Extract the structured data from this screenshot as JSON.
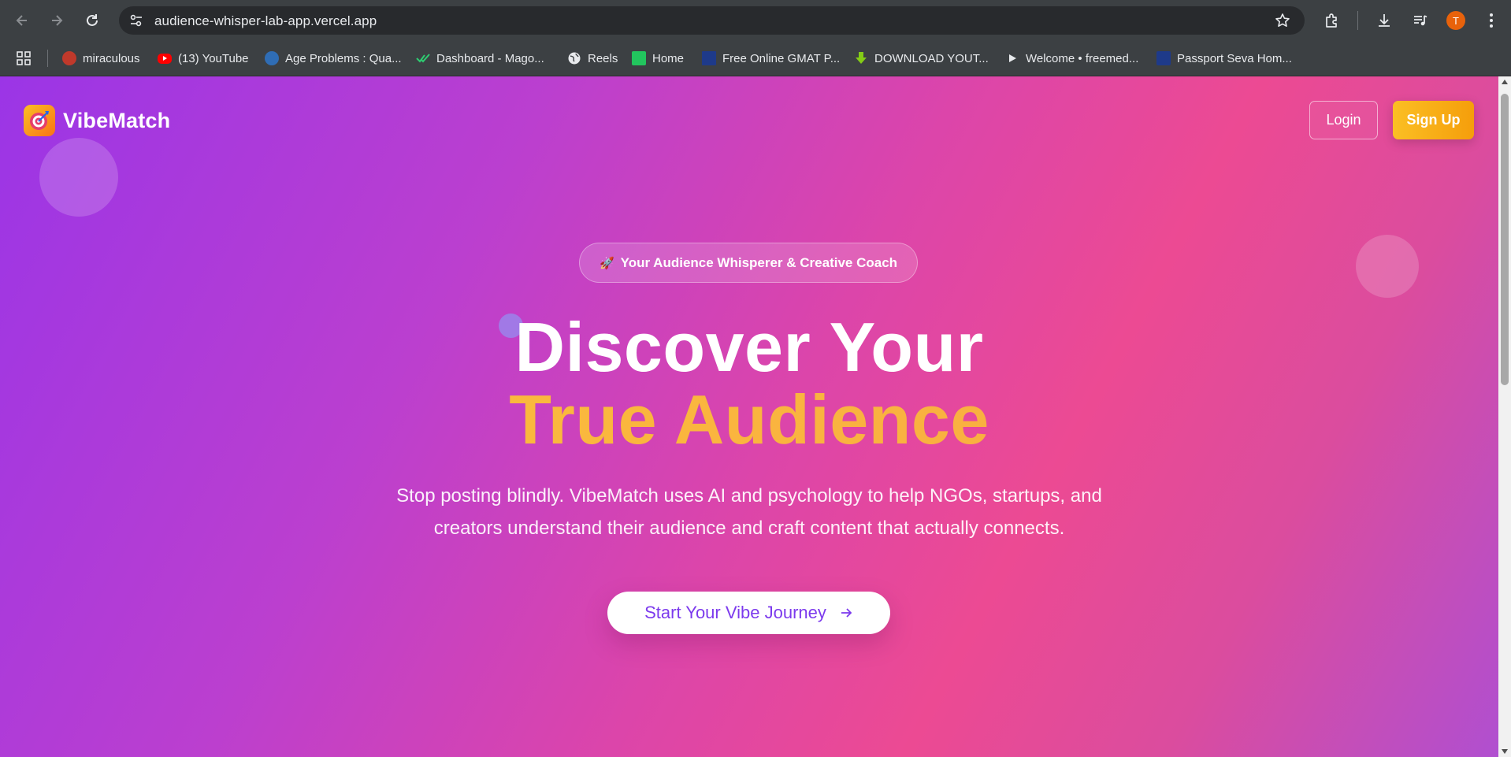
{
  "browser": {
    "url": "audience-whisper-lab-app.vercel.app",
    "profile_initial": "T",
    "bookmarks": [
      {
        "label": "miraculous",
        "icon": "ladybug-icon",
        "color": "#c0392b"
      },
      {
        "label": "(13) YouTube",
        "icon": "youtube-icon",
        "color": "#ff0000"
      },
      {
        "label": "Age Problems : Qua...",
        "icon": "site-icon",
        "color": "#4a90d9"
      },
      {
        "label": "Dashboard - Mago...",
        "icon": "check-icon",
        "color": "#2ecc71"
      },
      {
        "label": "Reels",
        "icon": "globe-icon",
        "color": "#e8eaed"
      },
      {
        "label": "Home",
        "icon": "square-icon",
        "color": "#22c55e"
      },
      {
        "label": "Free Online GMAT P...",
        "icon": "site-icon",
        "color": "#1e3a8a"
      },
      {
        "label": "DOWNLOAD YOUT...",
        "icon": "download-arrow-icon",
        "color": "#84cc16"
      },
      {
        "label": "Welcome • freemed...",
        "icon": "play-icon",
        "color": "#e8eaed"
      },
      {
        "label": "Passport Seva Hom...",
        "icon": "emblem-icon",
        "color": "#1e3a8a"
      }
    ]
  },
  "page": {
    "brand": "VibeMatch",
    "nav": {
      "login": "Login",
      "signup": "Sign Up"
    },
    "badge": {
      "emoji": "🚀",
      "text": "Your Audience Whisperer & Creative Coach"
    },
    "headline_line1": "Discover Your",
    "headline_line2": "True Audience",
    "subtitle_line1": "Stop posting blindly. VibeMatch uses AI and psychology to help NGOs, startups, and",
    "subtitle_line2": "creators understand their audience and craft content that actually connects.",
    "cta_label": "Start Your Vibe Journey"
  },
  "colors": {
    "accent_yellow": "#fbbf24",
    "cta_text": "#7c3aed",
    "gradient_start": "#9b35e6",
    "gradient_mid": "#ec4a93"
  }
}
